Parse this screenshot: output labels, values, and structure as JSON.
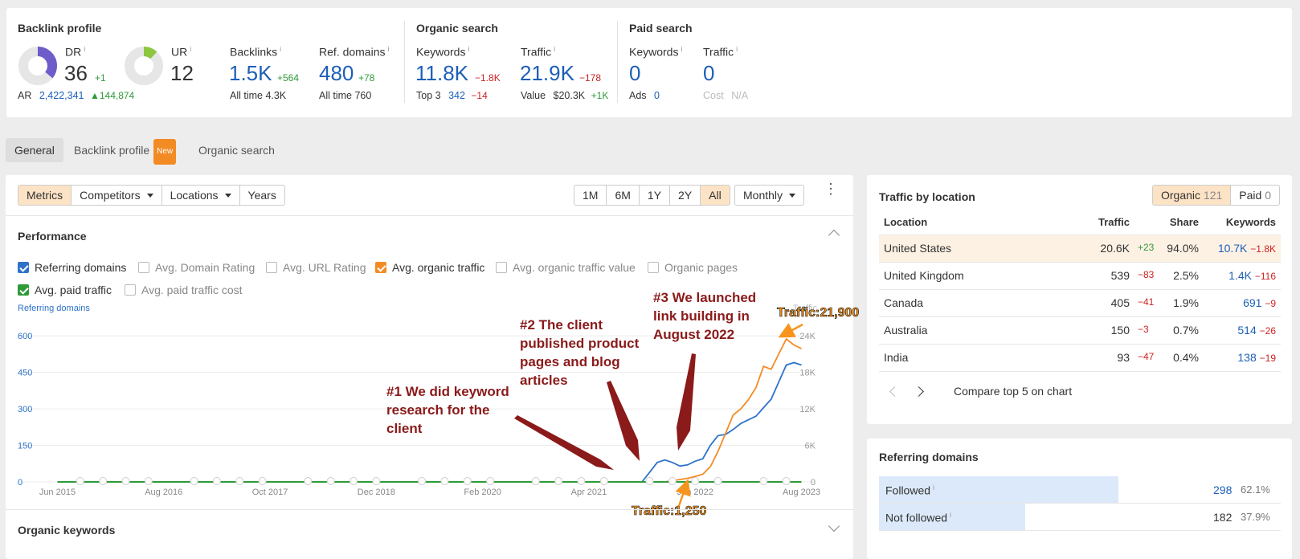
{
  "backlink_profile": {
    "title": "Backlink profile",
    "dr": {
      "label": "DR",
      "value": "36",
      "delta": "+1",
      "fill_fraction": 0.36,
      "color": "#6d5cc9"
    },
    "ur": {
      "label": "UR",
      "value": "12",
      "fill_fraction": 0.12,
      "color": "#8dc63f"
    },
    "ar": {
      "label": "AR",
      "value": "2,422,341",
      "delta": "144,874"
    },
    "backlinks": {
      "label": "Backlinks",
      "value": "1.5K",
      "delta": "+564",
      "sub_label": "All time",
      "sub_value": "4.3K"
    },
    "ref_domains": {
      "label": "Ref. domains",
      "value": "480",
      "delta": "+78",
      "sub_label": "All time",
      "sub_value": "760"
    }
  },
  "organic_search": {
    "title": "Organic search",
    "keywords": {
      "label": "Keywords",
      "value": "11.8K",
      "delta": "−1.8K",
      "sub_label": "Top 3",
      "sub_value": "342",
      "sub_delta": "−14"
    },
    "traffic": {
      "label": "Traffic",
      "value": "21.9K",
      "delta": "−178",
      "sub_label": "Value",
      "sub_value": "$20.3K",
      "sub_delta": "+1K"
    }
  },
  "paid_search": {
    "title": "Paid search",
    "keywords": {
      "label": "Keywords",
      "value": "0",
      "sub_label": "Ads",
      "sub_value": "0"
    },
    "traffic": {
      "label": "Traffic",
      "value": "0",
      "sub_label": "Cost",
      "sub_value": "N/A"
    }
  },
  "tabs": {
    "general": "General",
    "backlink_profile": "Backlink profile",
    "new_badge": "New",
    "organic_search": "Organic search"
  },
  "toolbar": {
    "metrics": "Metrics",
    "competitors": "Competitors",
    "locations": "Locations",
    "years": "Years",
    "ranges": [
      "1M",
      "6M",
      "1Y",
      "2Y",
      "All"
    ],
    "active_range": "All",
    "interval": "Monthly"
  },
  "performance": {
    "title": "Performance",
    "checkboxes": {
      "referring_domains": "Referring domains",
      "avg_domain_rating": "Avg. Domain Rating",
      "avg_url_rating": "Avg. URL Rating",
      "avg_organic_traffic": "Avg. organic traffic",
      "avg_organic_traffic_value": "Avg. organic traffic value",
      "organic_pages": "Organic pages",
      "avg_paid_traffic": "Avg. paid traffic",
      "avg_paid_traffic_cost": "Avg. paid traffic cost"
    },
    "axis_left_title": "Referring domains",
    "axis_right_title": "Traffic",
    "annotations": {
      "a1": "#1 We did keyword\nresearch for the\nclient",
      "a2": "#2 The client\npublished product\npages and blog\narticles",
      "a3": "#3 We launched\nlink building in\nAugust 2022",
      "traffic_high": "Traffic:21,900",
      "traffic_low": "Traffic:1,250"
    }
  },
  "chart_data": {
    "type": "line",
    "x_tick_labels": [
      "Jun 2015",
      "Aug 2016",
      "Oct 2017",
      "Dec 2018",
      "Feb 2020",
      "Apr 2021",
      "Jun 2022",
      "Aug 2023"
    ],
    "y_left": {
      "ticks": [
        0,
        150,
        300,
        450,
        600
      ],
      "range": [
        0,
        660
      ]
    },
    "y_right": {
      "ticks": [
        "0",
        "6K",
        "12K",
        "18K",
        "24K"
      ],
      "range": [
        0,
        26400
      ]
    },
    "grid": true,
    "series": [
      {
        "name": "Referring domains",
        "axis": "left",
        "color": "#2e73c9",
        "points": [
          [
            "2021-11",
            0
          ],
          [
            "2021-12",
            40
          ],
          [
            "2022-01",
            80
          ],
          [
            "2022-02",
            90
          ],
          [
            "2022-03",
            80
          ],
          [
            "2022-04",
            65
          ],
          [
            "2022-05",
            70
          ],
          [
            "2022-06",
            85
          ],
          [
            "2022-07",
            95
          ],
          [
            "2022-08",
            150
          ],
          [
            "2022-09",
            190
          ],
          [
            "2022-10",
            195
          ],
          [
            "2022-11",
            215
          ],
          [
            "2022-12",
            240
          ],
          [
            "2023-01",
            255
          ],
          [
            "2023-02",
            270
          ],
          [
            "2023-03",
            305
          ],
          [
            "2023-04",
            340
          ],
          [
            "2023-05",
            410
          ],
          [
            "2023-06",
            480
          ],
          [
            "2023-07",
            490
          ],
          [
            "2023-08",
            480
          ]
        ]
      },
      {
        "name": "Avg. organic traffic",
        "axis": "right",
        "color": "#f38b25",
        "points": [
          [
            "2022-02",
            0
          ],
          [
            "2022-03",
            200
          ],
          [
            "2022-04",
            400
          ],
          [
            "2022-05",
            600
          ],
          [
            "2022-06",
            900
          ],
          [
            "2022-07",
            1250
          ],
          [
            "2022-08",
            2500
          ],
          [
            "2022-09",
            5000
          ],
          [
            "2022-10",
            8000
          ],
          [
            "2022-11",
            11000
          ],
          [
            "2022-12",
            12000
          ],
          [
            "2023-01",
            13500
          ],
          [
            "2023-02",
            15500
          ],
          [
            "2023-03",
            19000
          ],
          [
            "2023-04",
            18500
          ],
          [
            "2023-05",
            21000
          ],
          [
            "2023-06",
            23500
          ],
          [
            "2023-07",
            22500
          ],
          [
            "2023-08",
            21900
          ]
        ]
      },
      {
        "name": "Avg. paid traffic",
        "axis": "right",
        "color": "#2e9a38",
        "points": [
          [
            "2015-06",
            0
          ],
          [
            "2023-08",
            0
          ]
        ]
      }
    ]
  },
  "organic_keywords": {
    "title": "Organic keywords"
  },
  "traffic_by_location": {
    "title": "Traffic by location",
    "organic_label": "Organic",
    "organic_count": "121",
    "paid_label": "Paid",
    "paid_count": "0",
    "columns": [
      "Location",
      "Traffic",
      "Share",
      "Keywords"
    ],
    "rows": [
      {
        "location": "United States",
        "traffic": "20.6K",
        "traffic_delta": "+23",
        "share": "94.0%",
        "keywords": "10.7K",
        "keywords_delta": "−1.8K"
      },
      {
        "location": "United Kingdom",
        "traffic": "539",
        "traffic_delta": "−83",
        "share": "2.5%",
        "keywords": "1.4K",
        "keywords_delta": "−116"
      },
      {
        "location": "Canada",
        "traffic": "405",
        "traffic_delta": "−41",
        "share": "1.9%",
        "keywords": "691",
        "keywords_delta": "−9"
      },
      {
        "location": "Australia",
        "traffic": "150",
        "traffic_delta": "−3",
        "share": "0.7%",
        "keywords": "514",
        "keywords_delta": "−26"
      },
      {
        "location": "India",
        "traffic": "93",
        "traffic_delta": "−47",
        "share": "0.4%",
        "keywords": "138",
        "keywords_delta": "−19"
      }
    ],
    "compare_label": "Compare top 5 on chart"
  },
  "referring_domains": {
    "title": "Referring domains",
    "rows": [
      {
        "label": "Followed",
        "value": "298",
        "share": "62.1%",
        "fraction": 0.621
      },
      {
        "label": "Not followed",
        "value": "182",
        "share": "37.9%",
        "fraction": 0.379
      }
    ]
  },
  "colors": {
    "accent_blue": "#1d5fb8",
    "orange": "#f38b25",
    "green": "#2e9a38",
    "red": "#cc2222",
    "annotation": "#8b1a1a"
  }
}
